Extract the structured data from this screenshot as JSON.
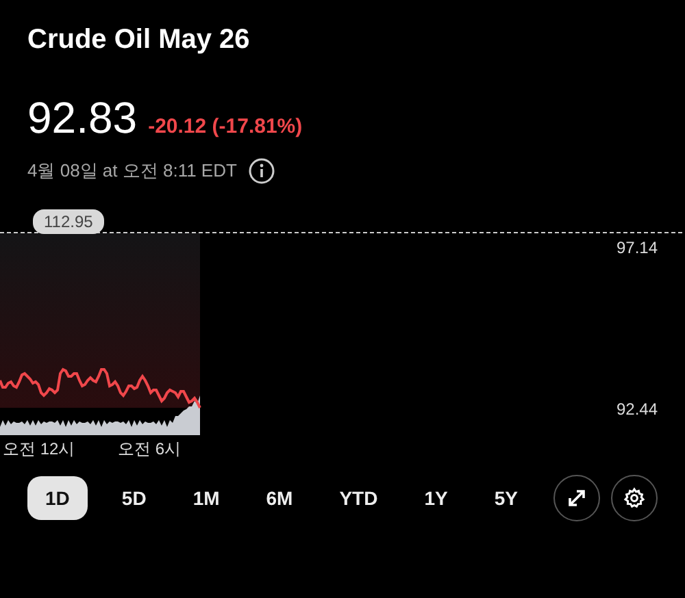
{
  "title": "Crude Oil May 26",
  "quote": {
    "price": "92.83",
    "change": "-20.12 (-17.81%)",
    "falling": true,
    "timestamp": "4월 08일 at 오전 8:11 EDT"
  },
  "chart": {
    "previous_close_label": "112.95",
    "y_labels": [
      "97.14",
      "92.44"
    ],
    "x_labels": [
      "오전 12시",
      "오전 6시"
    ]
  },
  "ranges": [
    {
      "label": "1D",
      "selected": true
    },
    {
      "label": "5D",
      "selected": false
    },
    {
      "label": "1M",
      "selected": false
    },
    {
      "label": "6M",
      "selected": false
    },
    {
      "label": "YTD",
      "selected": false
    },
    {
      "label": "1Y",
      "selected": false
    },
    {
      "label": "5Y",
      "selected": false
    }
  ]
}
